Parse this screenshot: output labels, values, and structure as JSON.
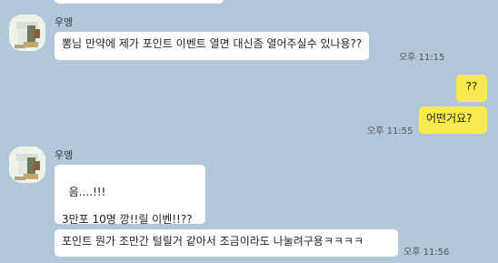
{
  "colors": {
    "background": "#b2c7da",
    "bubble_other": "#ffffff",
    "bubble_mine": "#fae94f"
  },
  "messages": [
    {
      "sender": "우엥",
      "text": "뽕님 만약에 제가 포인트 이벤트 열면 대신좀 열어주실수 있나용??",
      "time": "오후 11:15"
    },
    {
      "text": "??"
    },
    {
      "text": "어떤거요?",
      "time": "오후 11:55"
    },
    {
      "sender": "우엥",
      "text": "음....!!!\n\n3만포 10명 깡!!릴 이벤!!??"
    },
    {
      "text": "포인트 뭔가 조만간 털릴거 같아서 조금이라도 나눌려구용ㅋㅋㅋㅋ",
      "time": "오후 11:56"
    }
  ],
  "icons": {
    "avatar": "profile-photo"
  }
}
